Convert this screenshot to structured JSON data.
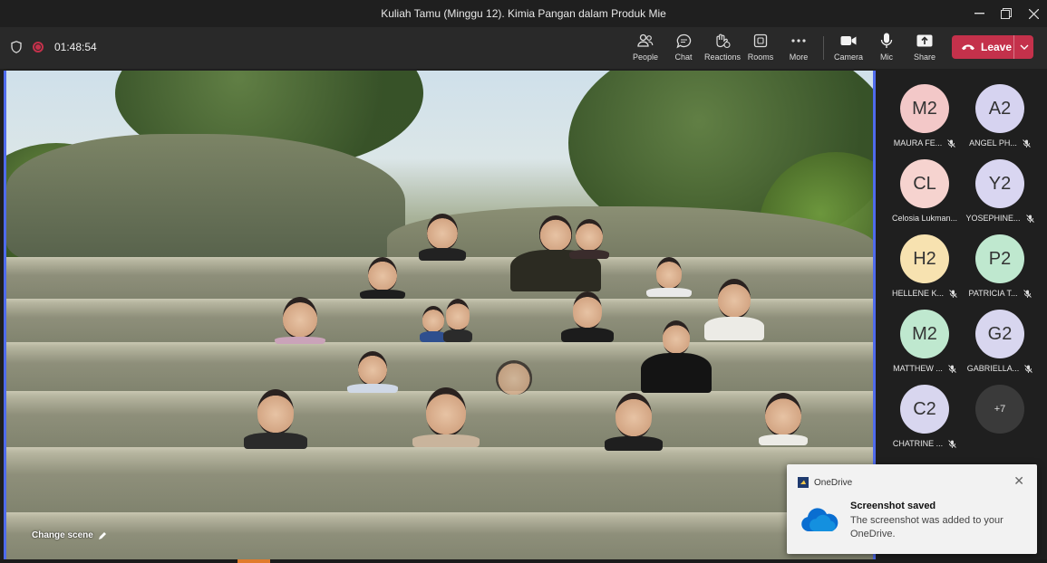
{
  "window": {
    "title": "Kuliah Tamu (Minggu 12). Kimia Pangan dalam Produk Mie",
    "controls": [
      "minimize-icon",
      "restore-icon",
      "close-icon"
    ]
  },
  "toolbar": {
    "timer": "01:48:54",
    "buttons": [
      {
        "label": "People",
        "icon": "people-icon"
      },
      {
        "label": "Chat",
        "icon": "chat-icon"
      },
      {
        "label": "Reactions",
        "icon": "reactions-icon"
      },
      {
        "label": "Rooms",
        "icon": "rooms-icon"
      },
      {
        "label": "More",
        "icon": "more-icon"
      },
      {
        "label": "Camera",
        "icon": "camera-icon"
      },
      {
        "label": "Mic",
        "icon": "mic-icon"
      },
      {
        "label": "Share",
        "icon": "share-icon"
      }
    ],
    "leave_label": "Leave",
    "leave_color": "#c4314b"
  },
  "stage": {
    "change_scene_label": "Change scene",
    "accent_color": "#4f6bed"
  },
  "participants": [
    {
      "initials": "M2",
      "name": "MAURA FE...",
      "color": "#f3c8c8"
    },
    {
      "initials": "A2",
      "name": "ANGEL PH...",
      "color": "#d6d3f0"
    },
    {
      "initials": "CL",
      "name": "Celosia Lukman...",
      "color": "#f6d3cf"
    },
    {
      "initials": "Y2",
      "name": "YOSEPHINE...",
      "color": "#d9d6f1"
    },
    {
      "initials": "H2",
      "name": "HELLENE K...",
      "color": "#f7e2b0"
    },
    {
      "initials": "P2",
      "name": "PATRICIA T...",
      "color": "#bfe8cf"
    },
    {
      "initials": "M2",
      "name": "MATTHEW ...",
      "color": "#bfe8cf"
    },
    {
      "initials": "G2",
      "name": "GABRIELLA...",
      "color": "#d8d6ef"
    },
    {
      "initials": "C2",
      "name": "CHATRINE ...",
      "color": "#d8d6ef"
    }
  ],
  "overflow": {
    "label": "+7"
  },
  "toast": {
    "app_name": "OneDrive",
    "heading": "Screenshot saved",
    "message": "The screenshot was added to your OneDrive."
  }
}
